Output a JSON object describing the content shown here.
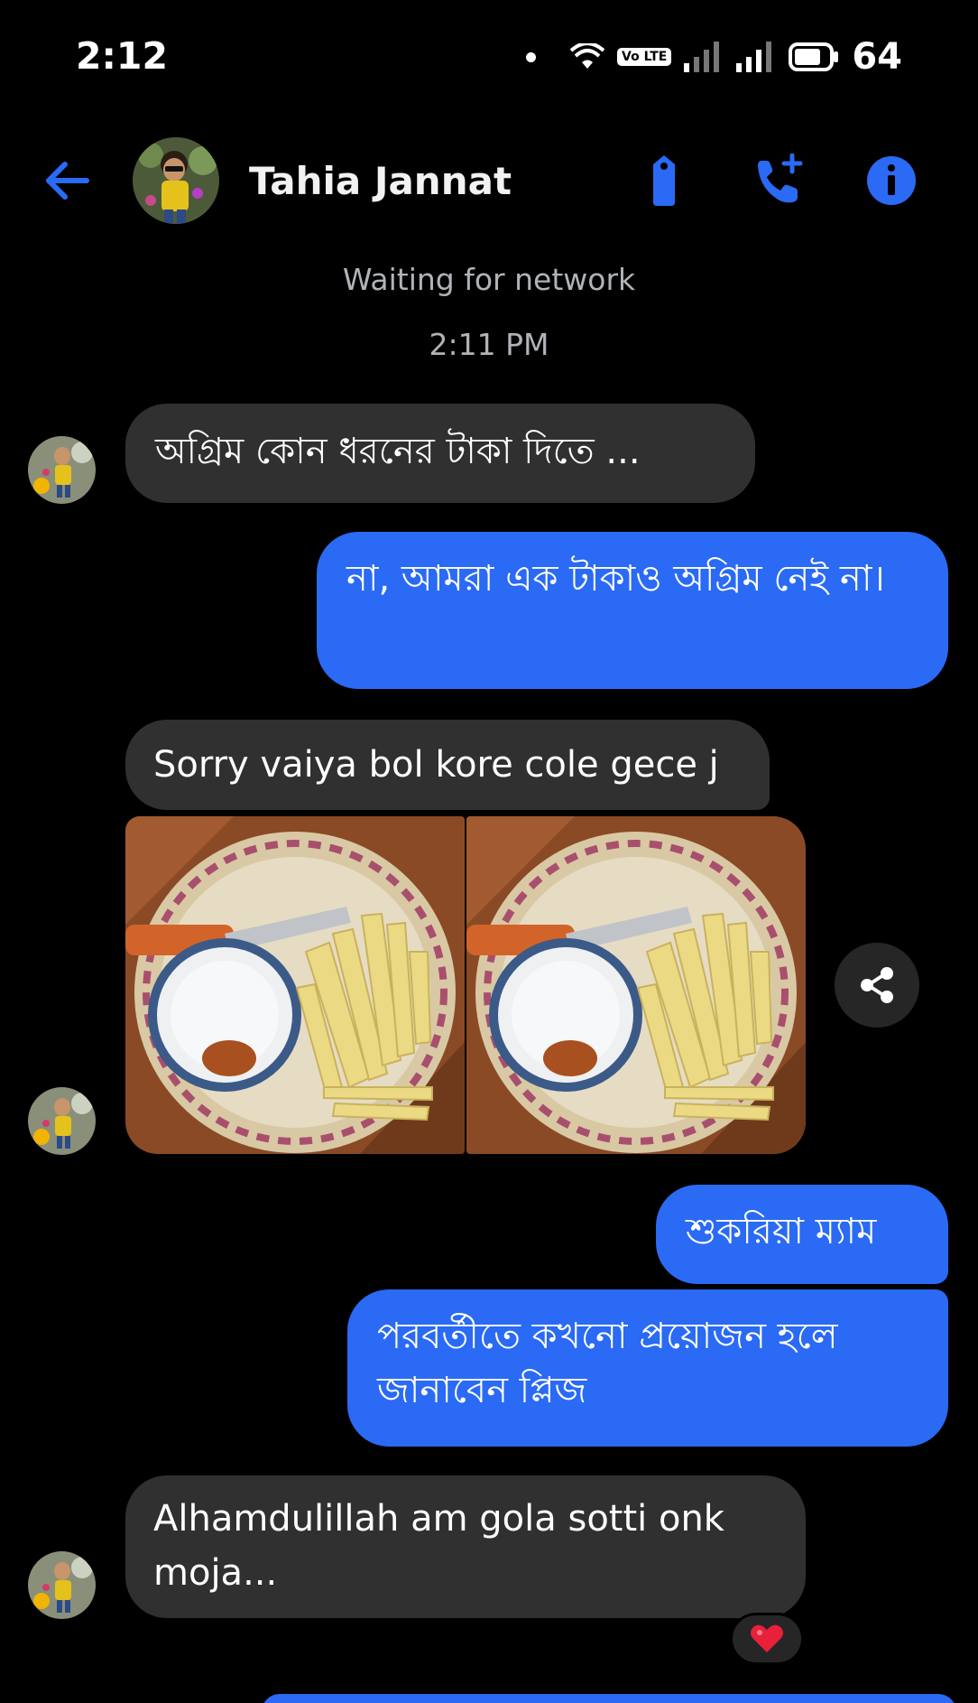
{
  "status_bar": {
    "time": "2:12",
    "volte_label": "Vo LTE",
    "battery": "64"
  },
  "header": {
    "contact_name": "Tahia Jannat",
    "back_icon": "arrow-left-icon",
    "avatar_icon": "profile-photo-icon",
    "tag_icon": "tag-icon",
    "call_icon": "add-call-icon",
    "info_icon": "info-icon",
    "accent_color": "#2a6af4"
  },
  "conversation": {
    "network_status": "Waiting for network",
    "timestamp": "2:11 PM"
  },
  "messages": [
    {
      "direction": "incoming",
      "text": "অগ্রিম কোন ধরনের টাকা দিতে ..."
    },
    {
      "direction": "outgoing",
      "text": "না, আমরা এক টাকাও অগ্রিম নেই না।"
    },
    {
      "direction": "incoming",
      "text": "Sorry vaiya bol kore cole gece j"
    },
    {
      "direction": "incoming",
      "type": "photos",
      "photo_icons": [
        "mango-slices-photo",
        "mango-slices-photo"
      ]
    },
    {
      "direction": "outgoing",
      "text": "শুকরিয়া ম্যাম"
    },
    {
      "direction": "outgoing",
      "text": "পরবর্তীতে কখনো প্রয়োজন হলে জানাবেন প্লিজ"
    },
    {
      "direction": "incoming",
      "text": "Alhamdulillah am gola sotti onk moja...",
      "reaction": "heart-icon"
    }
  ],
  "colors": {
    "incoming_bubble": "#303030",
    "outgoing_bubble": "#2a6af4",
    "background": "#000000",
    "muted_text": "#b0b3b8"
  }
}
